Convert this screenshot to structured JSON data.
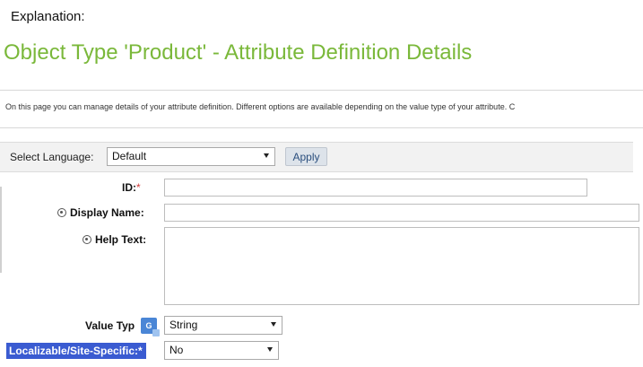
{
  "header": {
    "explanation": "Explanation:",
    "page_title": "Object Type 'Product' - Attribute Definition Details",
    "intro": "On this page you can manage details of your attribute definition. Different options are available depending on the value type of your attribute. C"
  },
  "language_bar": {
    "label": "Select Language:",
    "selected": "Default",
    "apply_label": "Apply"
  },
  "form": {
    "id_label": "ID:",
    "required_mark": "*",
    "id_value": "",
    "display_name_label": "Display Name:",
    "display_name_value": "",
    "help_text_label": "Help Text:",
    "help_text_value": "",
    "value_type_label": "Value Typ",
    "value_type_selected": "String",
    "localizable_label": "Localizable/Site-Specific:*",
    "localizable_selected": "No"
  },
  "icons": {
    "globe": "globe-icon",
    "translate": "translate-icon",
    "dropdown": "chevron-down-icon"
  },
  "colors": {
    "title_green": "#7ab83a",
    "highlight_blue": "#3a5bd1",
    "required_red": "#d23b3b"
  }
}
